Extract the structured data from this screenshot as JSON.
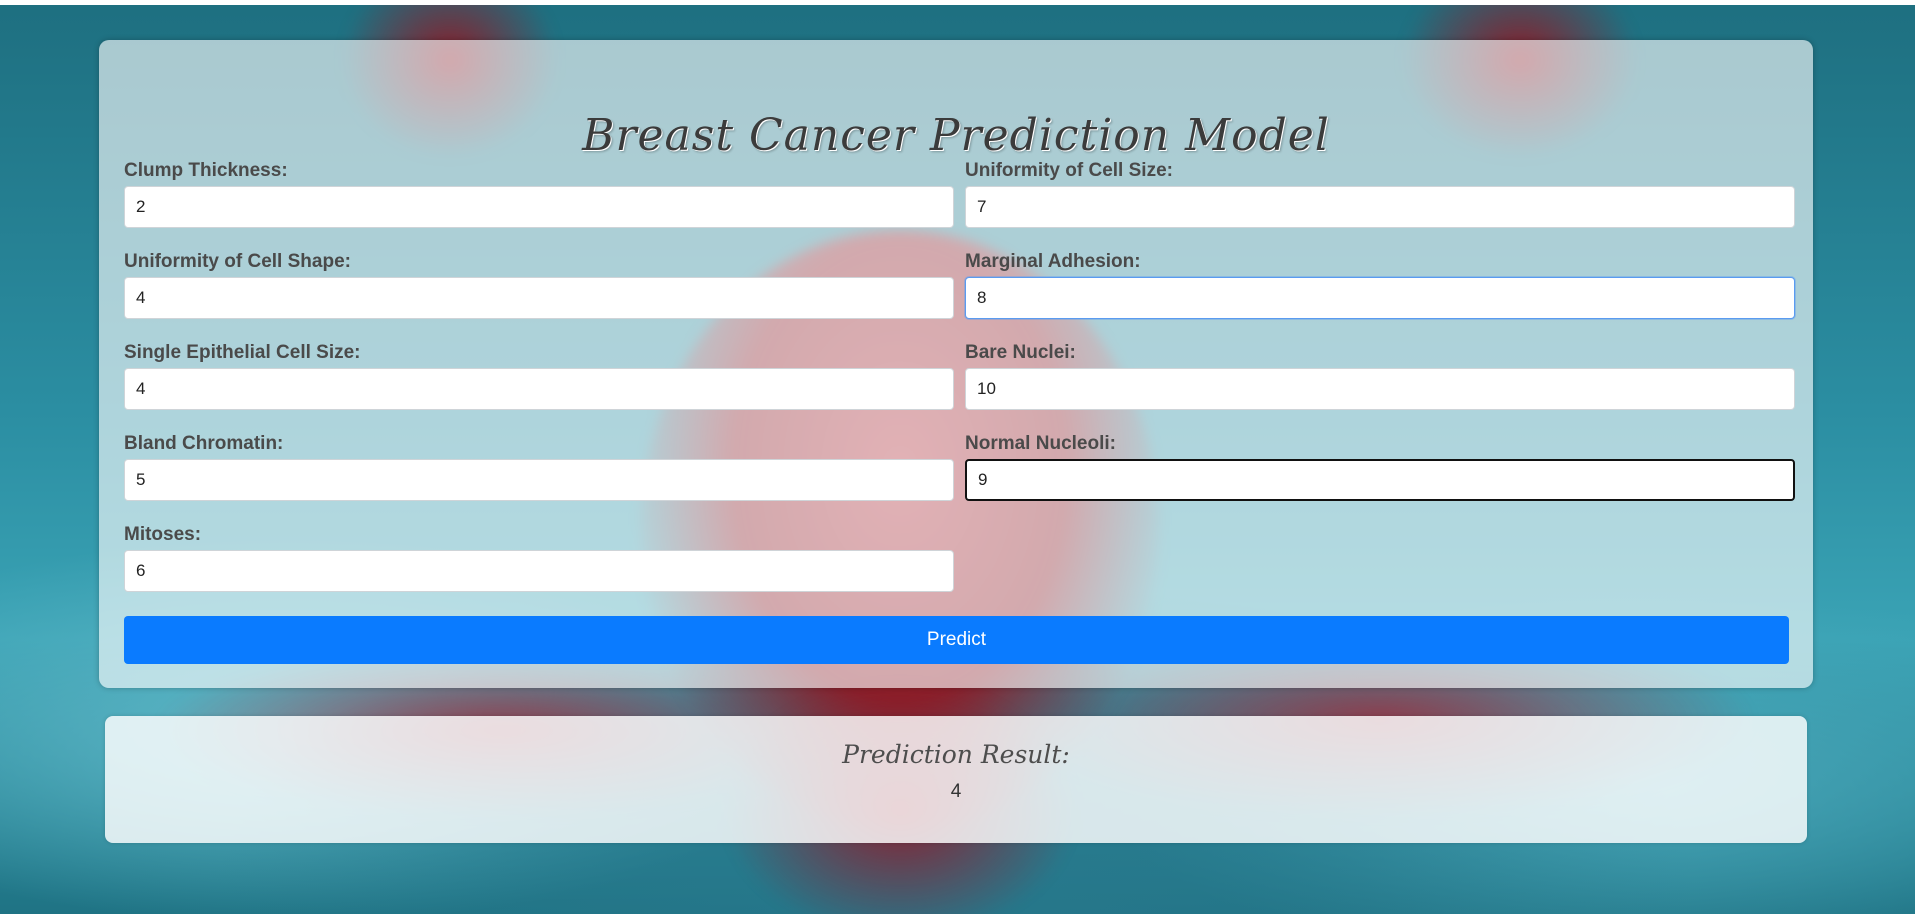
{
  "page": {
    "title": "Breast Cancer Prediction Model"
  },
  "form": {
    "fields": [
      {
        "label": "Clump Thickness:",
        "value": "2"
      },
      {
        "label": "Uniformity of Cell Size:",
        "value": "7"
      },
      {
        "label": "Uniformity of Cell Shape:",
        "value": "4"
      },
      {
        "label": "Marginal Adhesion:",
        "value": "8"
      },
      {
        "label": "Single Epithelial Cell Size:",
        "value": "4"
      },
      {
        "label": "Bare Nuclei:",
        "value": "10"
      },
      {
        "label": "Bland Chromatin:",
        "value": "5"
      },
      {
        "label": "Normal Nucleoli:",
        "value": "9"
      },
      {
        "label": "Mitoses:",
        "value": "6"
      }
    ],
    "predict_label": "Predict"
  },
  "result": {
    "title": "Prediction Result:",
    "value": "4"
  },
  "colors": {
    "primary_button": "#0a7bff",
    "focus_border": "#5a9bf0"
  }
}
